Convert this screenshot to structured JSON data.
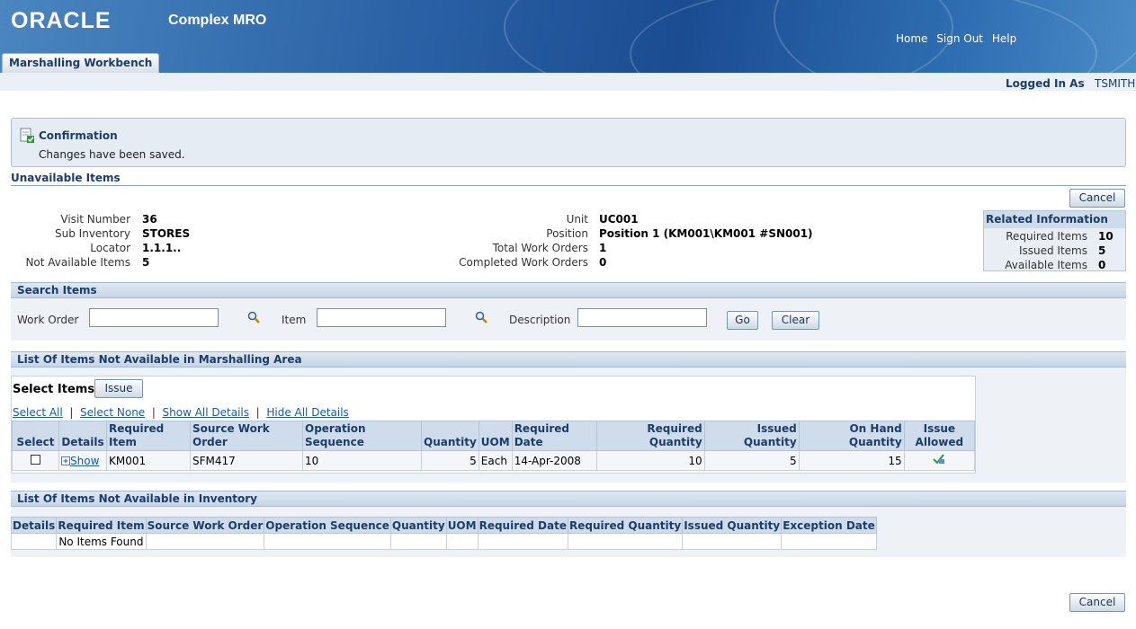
{
  "header": {
    "logo": "ORACLE",
    "app_name": "Complex MRO",
    "links": [
      "Home",
      "Sign Out",
      "Help"
    ]
  },
  "tab": {
    "label": "Marshalling Workbench"
  },
  "user": {
    "logged_label": "Logged In As",
    "username": "TSMITH"
  },
  "confirmation": {
    "title": "Confirmation",
    "message": "Changes have been saved."
  },
  "section_title": "Unavailable Items",
  "cancel_label": "Cancel",
  "info_left": [
    {
      "label": "Visit Number",
      "value": "36"
    },
    {
      "label": "Sub Inventory",
      "value": "STORES"
    },
    {
      "label": "Locator",
      "value": "1.1.1.."
    },
    {
      "label": "Not Available Items",
      "value": "5"
    }
  ],
  "info_mid": [
    {
      "label": "Unit",
      "value": "UC001"
    },
    {
      "label": "Position",
      "value": "Position 1 (KM001\\KM001 #SN001)"
    },
    {
      "label": "Total Work Orders",
      "value": "1"
    },
    {
      "label": "Completed Work Orders",
      "value": "0"
    }
  ],
  "related": {
    "title": "Related Information",
    "items": [
      {
        "label": "Required Items",
        "value": "10"
      },
      {
        "label": "Issued Items",
        "value": "5"
      },
      {
        "label": "Available Items",
        "value": "0"
      }
    ]
  },
  "search": {
    "title": "Search Items",
    "work_order_label": "Work Order",
    "item_label": "Item",
    "description_label": "Description",
    "work_order_value": "",
    "item_value": "",
    "description_value": "",
    "go_label": "Go",
    "clear_label": "Clear"
  },
  "list1": {
    "title": "List Of Items Not Available in Marshalling Area",
    "select_items_label": "Select Items:",
    "issue_label": "Issue",
    "links": [
      "Select All",
      "Select None",
      "Show All Details",
      "Hide All Details"
    ],
    "columns": [
      "Select",
      "Details",
      "Required Item",
      "Source Work Order",
      "Operation Sequence",
      "Quantity",
      "UOM",
      "Required Date",
      "Required Quantity",
      "Issued Quantity",
      "On Hand Quantity",
      "Issue Allowed"
    ],
    "rows": [
      {
        "details": "Show",
        "item": "KM001",
        "work_order": "SFM417",
        "op_seq": "10",
        "quantity": "5",
        "uom": "Each",
        "date": "14-Apr-2008",
        "req_qty": "10",
        "issued_qty": "5",
        "onhand_qty": "15"
      }
    ]
  },
  "list2": {
    "title": "List Of Items Not Available in Inventory",
    "columns": [
      "Details",
      "Required Item",
      "Source Work Order",
      "Operation Sequence",
      "Quantity",
      "UOM",
      "Required Date",
      "Required Quantity",
      "Issued Quantity",
      "Exception Date"
    ],
    "empty_text": "No Items Found"
  }
}
